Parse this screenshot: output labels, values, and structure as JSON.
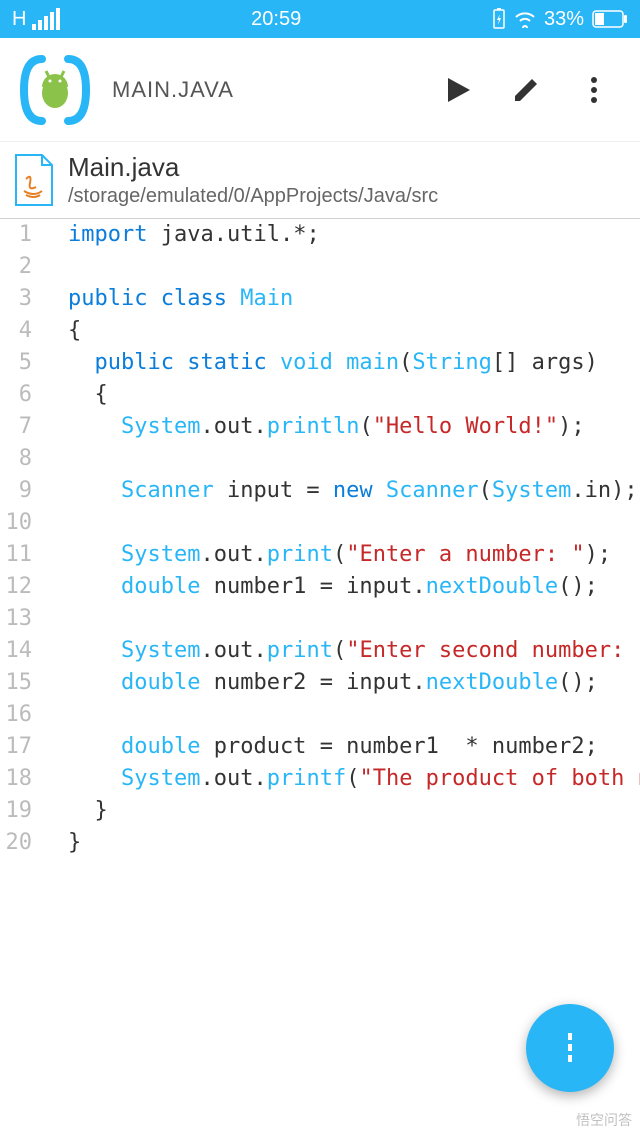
{
  "status": {
    "network": "H",
    "time": "20:59",
    "battery_pct": "33%"
  },
  "appbar": {
    "title": "MAIN.JAVA"
  },
  "file": {
    "name": "Main.java",
    "path": "/storage/emulated/0/AppProjects/Java/src"
  },
  "code": {
    "lines": [
      {
        "n": "1",
        "tokens": [
          {
            "t": "kw",
            "v": "import"
          },
          {
            "t": "plain",
            "v": " java"
          },
          {
            "t": "punct",
            "v": "."
          },
          {
            "t": "plain",
            "v": "util"
          },
          {
            "t": "punct",
            "v": "."
          },
          {
            "t": "punct",
            "v": "*"
          },
          {
            "t": "punct",
            "v": ";"
          }
        ]
      },
      {
        "n": "2",
        "tokens": []
      },
      {
        "n": "3",
        "tokens": [
          {
            "t": "kw",
            "v": "public class"
          },
          {
            "t": "plain",
            "v": " "
          },
          {
            "t": "cls",
            "v": "Main"
          }
        ]
      },
      {
        "n": "4",
        "tokens": [
          {
            "t": "punct",
            "v": "{"
          }
        ]
      },
      {
        "n": "5",
        "tokens": [
          {
            "t": "plain",
            "v": "  "
          },
          {
            "t": "kw",
            "v": "public static"
          },
          {
            "t": "plain",
            "v": " "
          },
          {
            "t": "type",
            "v": "void"
          },
          {
            "t": "plain",
            "v": " "
          },
          {
            "t": "method",
            "v": "main"
          },
          {
            "t": "punct",
            "v": "("
          },
          {
            "t": "cls",
            "v": "String"
          },
          {
            "t": "punct",
            "v": "[]"
          },
          {
            "t": "plain",
            "v": " args"
          },
          {
            "t": "punct",
            "v": ")"
          }
        ]
      },
      {
        "n": "6",
        "tokens": [
          {
            "t": "plain",
            "v": "  "
          },
          {
            "t": "punct",
            "v": "{"
          }
        ]
      },
      {
        "n": "7",
        "tokens": [
          {
            "t": "plain",
            "v": "    "
          },
          {
            "t": "cls",
            "v": "System"
          },
          {
            "t": "punct",
            "v": "."
          },
          {
            "t": "plain",
            "v": "out"
          },
          {
            "t": "punct",
            "v": "."
          },
          {
            "t": "method",
            "v": "println"
          },
          {
            "t": "punct",
            "v": "("
          },
          {
            "t": "str",
            "v": "\"Hello World!\""
          },
          {
            "t": "punct",
            "v": ");"
          }
        ]
      },
      {
        "n": "8",
        "tokens": []
      },
      {
        "n": "9",
        "tokens": [
          {
            "t": "plain",
            "v": "    "
          },
          {
            "t": "cls",
            "v": "Scanner"
          },
          {
            "t": "plain",
            "v": " input "
          },
          {
            "t": "punct",
            "v": "="
          },
          {
            "t": "plain",
            "v": " "
          },
          {
            "t": "kw",
            "v": "new"
          },
          {
            "t": "plain",
            "v": " "
          },
          {
            "t": "cls",
            "v": "Scanner"
          },
          {
            "t": "punct",
            "v": "("
          },
          {
            "t": "cls",
            "v": "System"
          },
          {
            "t": "punct",
            "v": "."
          },
          {
            "t": "plain",
            "v": "in"
          },
          {
            "t": "punct",
            "v": ");"
          }
        ]
      },
      {
        "n": "10",
        "tokens": []
      },
      {
        "n": "11",
        "tokens": [
          {
            "t": "plain",
            "v": "    "
          },
          {
            "t": "cls",
            "v": "System"
          },
          {
            "t": "punct",
            "v": "."
          },
          {
            "t": "plain",
            "v": "out"
          },
          {
            "t": "punct",
            "v": "."
          },
          {
            "t": "method",
            "v": "print"
          },
          {
            "t": "punct",
            "v": "("
          },
          {
            "t": "str",
            "v": "\"Enter a number: \""
          },
          {
            "t": "punct",
            "v": ");"
          }
        ]
      },
      {
        "n": "12",
        "tokens": [
          {
            "t": "plain",
            "v": "    "
          },
          {
            "t": "type",
            "v": "double"
          },
          {
            "t": "plain",
            "v": " number1 "
          },
          {
            "t": "punct",
            "v": "="
          },
          {
            "t": "plain",
            "v": " input"
          },
          {
            "t": "punct",
            "v": "."
          },
          {
            "t": "method",
            "v": "nextDouble"
          },
          {
            "t": "punct",
            "v": "();"
          }
        ]
      },
      {
        "n": "13",
        "tokens": []
      },
      {
        "n": "14",
        "tokens": [
          {
            "t": "plain",
            "v": "    "
          },
          {
            "t": "cls",
            "v": "System"
          },
          {
            "t": "punct",
            "v": "."
          },
          {
            "t": "plain",
            "v": "out"
          },
          {
            "t": "punct",
            "v": "."
          },
          {
            "t": "method",
            "v": "print"
          },
          {
            "t": "punct",
            "v": "("
          },
          {
            "t": "str",
            "v": "\"Enter second number: \""
          },
          {
            "t": "punct",
            "v": ");"
          }
        ]
      },
      {
        "n": "15",
        "tokens": [
          {
            "t": "plain",
            "v": "    "
          },
          {
            "t": "type",
            "v": "double"
          },
          {
            "t": "plain",
            "v": " number2 "
          },
          {
            "t": "punct",
            "v": "="
          },
          {
            "t": "plain",
            "v": " input"
          },
          {
            "t": "punct",
            "v": "."
          },
          {
            "t": "method",
            "v": "nextDouble"
          },
          {
            "t": "punct",
            "v": "();"
          }
        ]
      },
      {
        "n": "16",
        "tokens": []
      },
      {
        "n": "17",
        "tokens": [
          {
            "t": "plain",
            "v": "    "
          },
          {
            "t": "type",
            "v": "double"
          },
          {
            "t": "plain",
            "v": " product "
          },
          {
            "t": "punct",
            "v": "="
          },
          {
            "t": "plain",
            "v": " number1  "
          },
          {
            "t": "punct",
            "v": "*"
          },
          {
            "t": "plain",
            "v": " number2"
          },
          {
            "t": "punct",
            "v": ";"
          }
        ]
      },
      {
        "n": "18",
        "tokens": [
          {
            "t": "plain",
            "v": "    "
          },
          {
            "t": "cls",
            "v": "System"
          },
          {
            "t": "punct",
            "v": "."
          },
          {
            "t": "plain",
            "v": "out"
          },
          {
            "t": "punct",
            "v": "."
          },
          {
            "t": "method",
            "v": "printf"
          },
          {
            "t": "punct",
            "v": "("
          },
          {
            "t": "str",
            "v": "\"The product of both numbers"
          }
        ]
      },
      {
        "n": "19",
        "tokens": [
          {
            "t": "plain",
            "v": "  "
          },
          {
            "t": "punct",
            "v": "}"
          }
        ]
      },
      {
        "n": "20",
        "tokens": [
          {
            "t": "punct",
            "v": "}"
          }
        ]
      }
    ]
  },
  "watermark": "悟空问答"
}
